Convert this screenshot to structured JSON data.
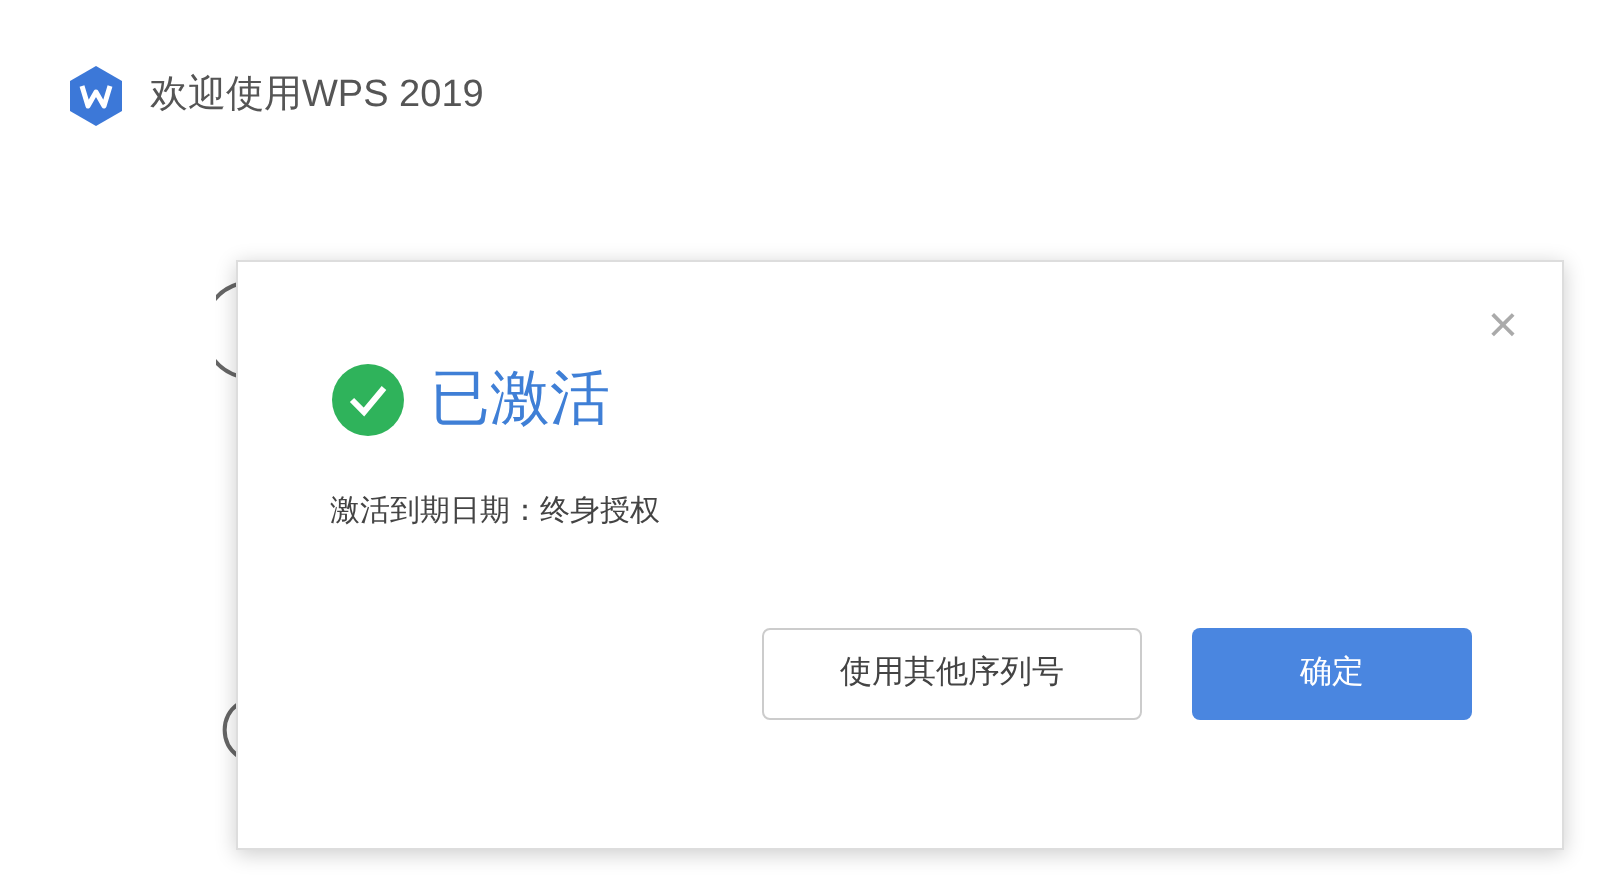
{
  "window": {
    "title": "欢迎使用WPS 2019"
  },
  "dialog": {
    "close": "×",
    "status": {
      "title": "已激活",
      "activated": true
    },
    "message": "激活到期日期：终身授权",
    "buttons": [
      {
        "label": "使用其他序列号",
        "kind": "secondary"
      },
      {
        "label": "确定",
        "kind": "primary"
      }
    ]
  }
}
